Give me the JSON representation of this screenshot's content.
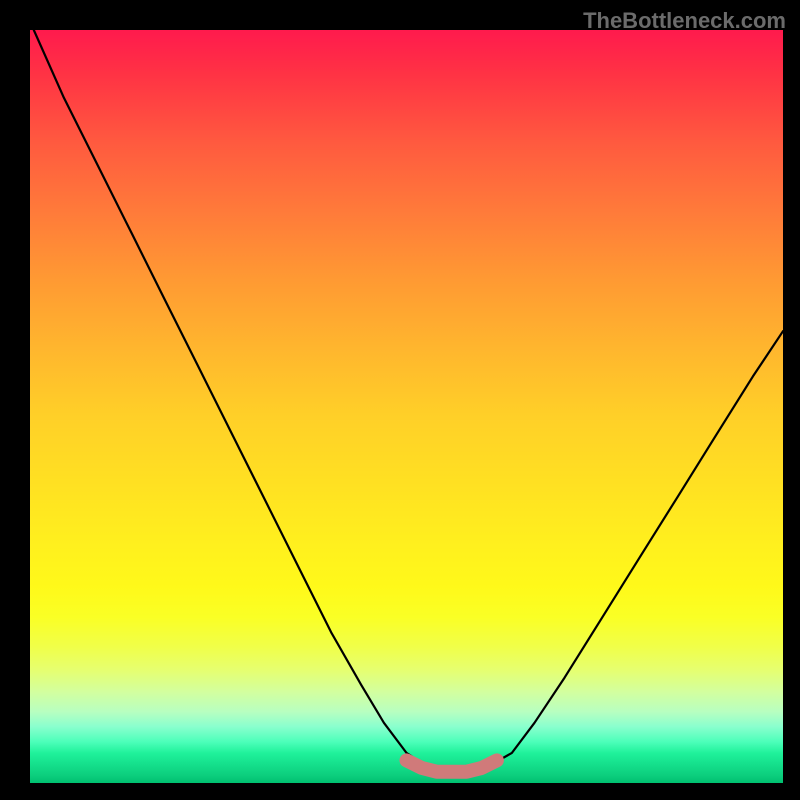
{
  "watermark": "TheBottleneck.com",
  "chart_data": {
    "type": "line",
    "title": "",
    "xlabel": "",
    "ylabel": "",
    "xlim": [
      0,
      100
    ],
    "ylim": [
      0,
      100
    ],
    "series": [
      {
        "name": "bottleneck-curve",
        "x": [
          0.5,
          4.5,
          9,
          13.5,
          18,
          22.5,
          27,
          31.5,
          36,
          40,
          44,
          47,
          50,
          53,
          55.5,
          58,
          60.5,
          64,
          67,
          71,
          76,
          81,
          86,
          91,
          96,
          100
        ],
        "values": [
          100,
          91,
          82,
          73,
          64,
          55,
          46,
          37,
          28,
          20,
          13,
          8,
          4,
          2,
          1.5,
          1.5,
          2,
          4,
          8,
          14,
          22,
          30,
          38,
          46,
          54,
          60
        ]
      },
      {
        "name": "minimum-band",
        "x": [
          50,
          52,
          54,
          56,
          58,
          60,
          62
        ],
        "values": [
          3,
          2,
          1.5,
          1.5,
          1.5,
          2,
          3
        ]
      }
    ],
    "background": {
      "type": "vertical-gradient",
      "stops": [
        {
          "pos": 0,
          "color": "#ff1a4d"
        },
        {
          "pos": 25,
          "color": "#ff7a3a"
        },
        {
          "pos": 50,
          "color": "#ffcf28"
        },
        {
          "pos": 75,
          "color": "#fff91a"
        },
        {
          "pos": 90,
          "color": "#b8ffc0"
        },
        {
          "pos": 100,
          "color": "#00c070"
        }
      ]
    }
  }
}
